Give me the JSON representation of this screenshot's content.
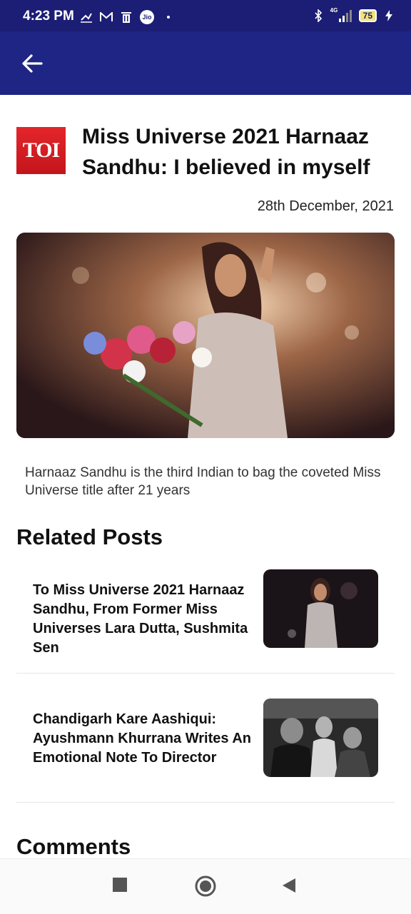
{
  "status_bar": {
    "time": "4:23 PM",
    "carrier_badge": "Jio",
    "network": "4G",
    "battery": "75",
    "icons": [
      "missed-call-icon",
      "gmail-icon",
      "trash-icon",
      "jio-icon",
      "dot-icon",
      "bluetooth-icon",
      "signal-icon",
      "battery-icon",
      "charging-icon"
    ]
  },
  "app_bar": {
    "back_icon": "arrow-left-icon",
    "color": "#1f2585"
  },
  "article": {
    "source_logo": "TOI",
    "title": "Miss Universe 2021 Harnaaz Sandhu: I believed in myself",
    "date": "28th December, 2021",
    "image_caption": "Harnaaz Sandhu is the third Indian to bag the coveted Miss Universe title after 21 years"
  },
  "related": {
    "heading": "Related Posts",
    "posts": [
      {
        "title": "To Miss Universe 2021 Harnaaz Sandhu, From Former Miss Universes Lara Dutta, Sushmita Sen"
      },
      {
        "title": "Chandigarh Kare Aashiqui: Ayushmann Khurrana Writes An Emotional Note To Director"
      }
    ]
  },
  "comments": {
    "heading": "Comments"
  },
  "nav_bar": {
    "icons": [
      "recents-square-icon",
      "home-circle-icon",
      "back-triangle-icon"
    ]
  }
}
